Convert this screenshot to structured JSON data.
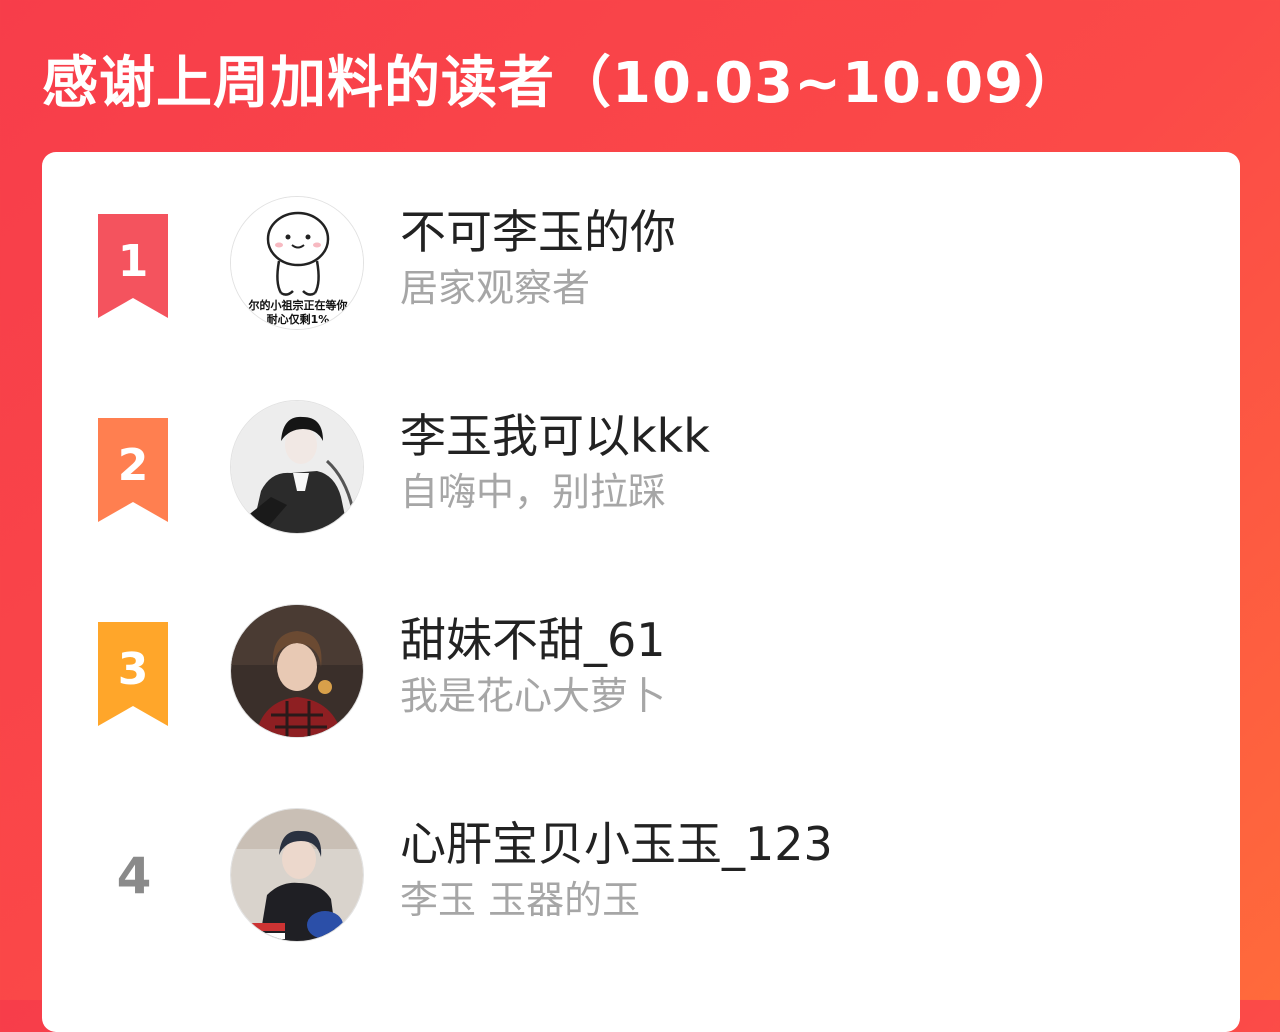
{
  "header": {
    "title": "感谢上周加料的读者（10.03~10.09）"
  },
  "colors": {
    "background_start": "#f73d4a",
    "background_end": "#ff6a3b",
    "rank1_badge": "#f4535e",
    "rank2_badge": "#ff7f50",
    "rank3_badge": "#ffa62a",
    "rank_plain_text": "#8a8a8a",
    "name_text": "#222222",
    "subtitle_text": "#a6a6a6"
  },
  "readers": [
    {
      "rank": "1",
      "name": "不可李玉的你",
      "subtitle": "居家观察者",
      "avatar_icon": "cartoon-figure-avatar",
      "avatar_caption": [
        "尔的小祖宗正在等你",
        "耐心仅剩1%"
      ]
    },
    {
      "rank": "2",
      "name": "李玉我可以kkk",
      "subtitle": "自嗨中，别拉踩",
      "avatar_icon": "anime-man-avatar"
    },
    {
      "rank": "3",
      "name": "甜妹不甜_61",
      "subtitle": "我是花心大萝卜",
      "avatar_icon": "girl-photo-avatar"
    },
    {
      "rank": "4",
      "name": "心肝宝贝小玉玉_123",
      "subtitle": "李玉 玉器的玉",
      "avatar_icon": "boxer-anime-avatar"
    }
  ]
}
